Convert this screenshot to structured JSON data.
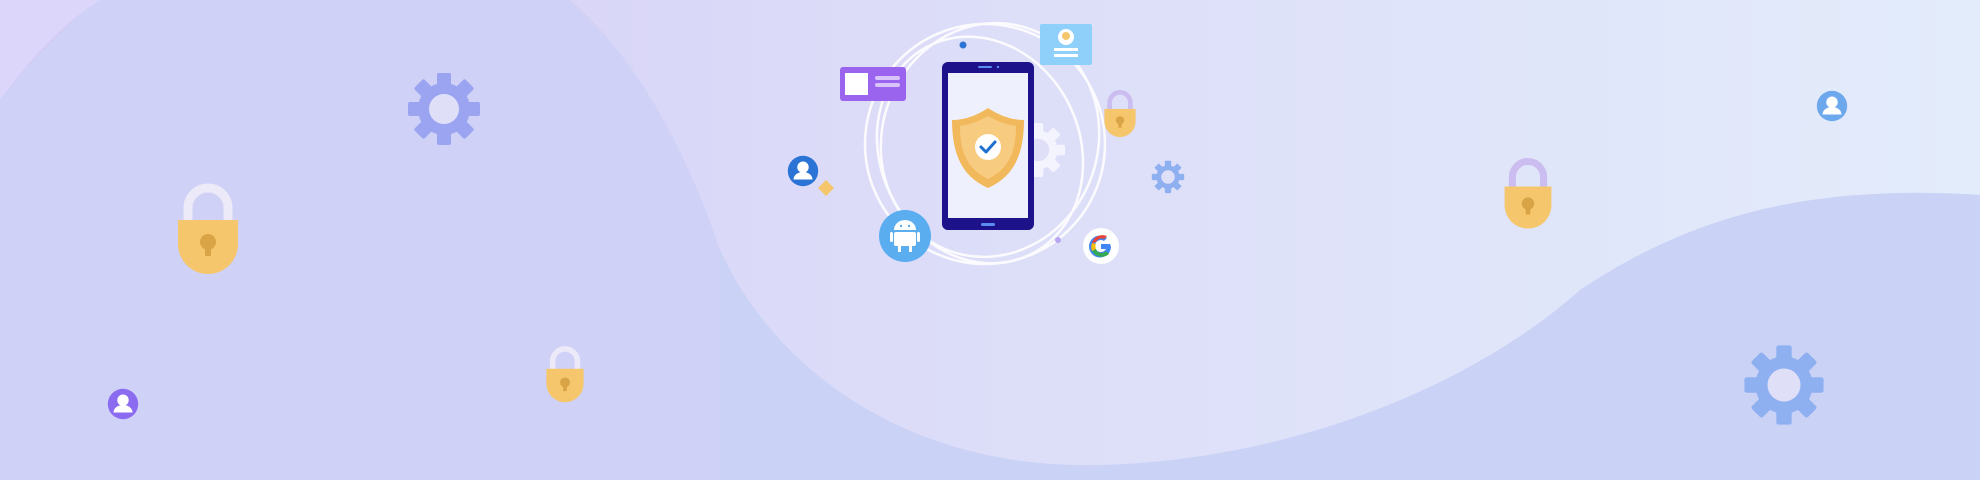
{
  "banner": {
    "colors": {
      "bg_left": "#d4cdf5",
      "bg_right": "#e2ebfb",
      "wave_light": "#dde0f7",
      "wave_blue": "#c9d4f5",
      "lock_body": "#f5c66b",
      "lock_shackle": "#e9e6f6",
      "lock_shackle_purple": "#cbbdf0",
      "gear_purple": "#9aa4f0",
      "gear_blue": "#8fb0f0",
      "phone_frame": "#1d128a",
      "phone_screen": "#eef1fd",
      "shield": "#f2b85c",
      "check": "#1f6fd1",
      "android": "#5aaef0",
      "user_blue": "#2b74d6",
      "user_purple": "#8b6cf0",
      "user_light": "#6ea8ec",
      "card_purple": "#9b64ee",
      "id_card": "#8fd0fb",
      "orbit": "#ffffff"
    },
    "icons": [
      "gear-icon",
      "padlock-icon",
      "user-avatar-icon",
      "phone-icon",
      "security-shield-icon",
      "checkmark-icon",
      "android-icon",
      "google-icon",
      "id-card-icon",
      "profile-card-icon",
      "sparkle-icon"
    ]
  }
}
